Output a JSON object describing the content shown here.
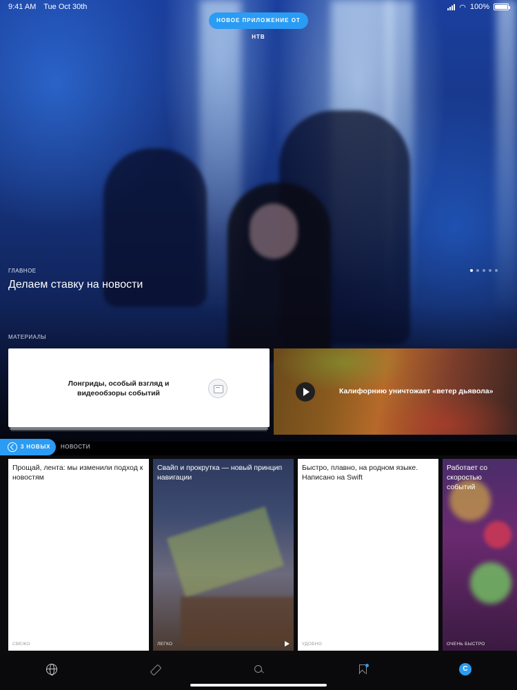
{
  "status_bar": {
    "time": "9:41 AM",
    "date": "Tue Oct 30th",
    "battery": "100%",
    "icons": [
      "signal-icon",
      "wifi-icon",
      "battery-icon"
    ]
  },
  "promo": {
    "label": "НОВОЕ ПРИЛОЖЕНИЕ ОТ НТВ"
  },
  "hero": {
    "kicker": "ГЛАВНОЕ",
    "title": "Делаем ставку на новости",
    "pages": 5,
    "active_page": 1
  },
  "materials": {
    "section_label": "МАТЕРИАЛЫ",
    "cards": [
      {
        "title": "Лонгриды, особый взгляд и видеообзоры событий",
        "icon": "document-icon"
      },
      {
        "title": "Калифорнию уничтожает «ветер дьявола»",
        "icon": "play-icon"
      }
    ]
  },
  "news": {
    "new_count_label": "3 НОВЫХ",
    "section_label": "НОВОСТИ",
    "cards": [
      {
        "title": "Прощай, лента: мы изменили подход к новостям",
        "tag": "СВЕЖО"
      },
      {
        "title": "Свайп и прокрутка — новый принцип навигации",
        "tag": "ЛЕГКО"
      },
      {
        "title": "Быстро, плавно, на родном языке. Написано на Swift",
        "tag": "УДОБНО"
      },
      {
        "title": "Работает со скоростью событий",
        "tag": "ОЧЕНЬ БЫСТРО"
      }
    ]
  },
  "tab_bar": {
    "tabs": [
      "globe-icon",
      "eraser-icon",
      "search-icon",
      "bookmark-icon",
      "profile-icon"
    ],
    "profile_letter": "С"
  },
  "colors": {
    "accent": "#2a9cf4",
    "background": "#000000"
  }
}
